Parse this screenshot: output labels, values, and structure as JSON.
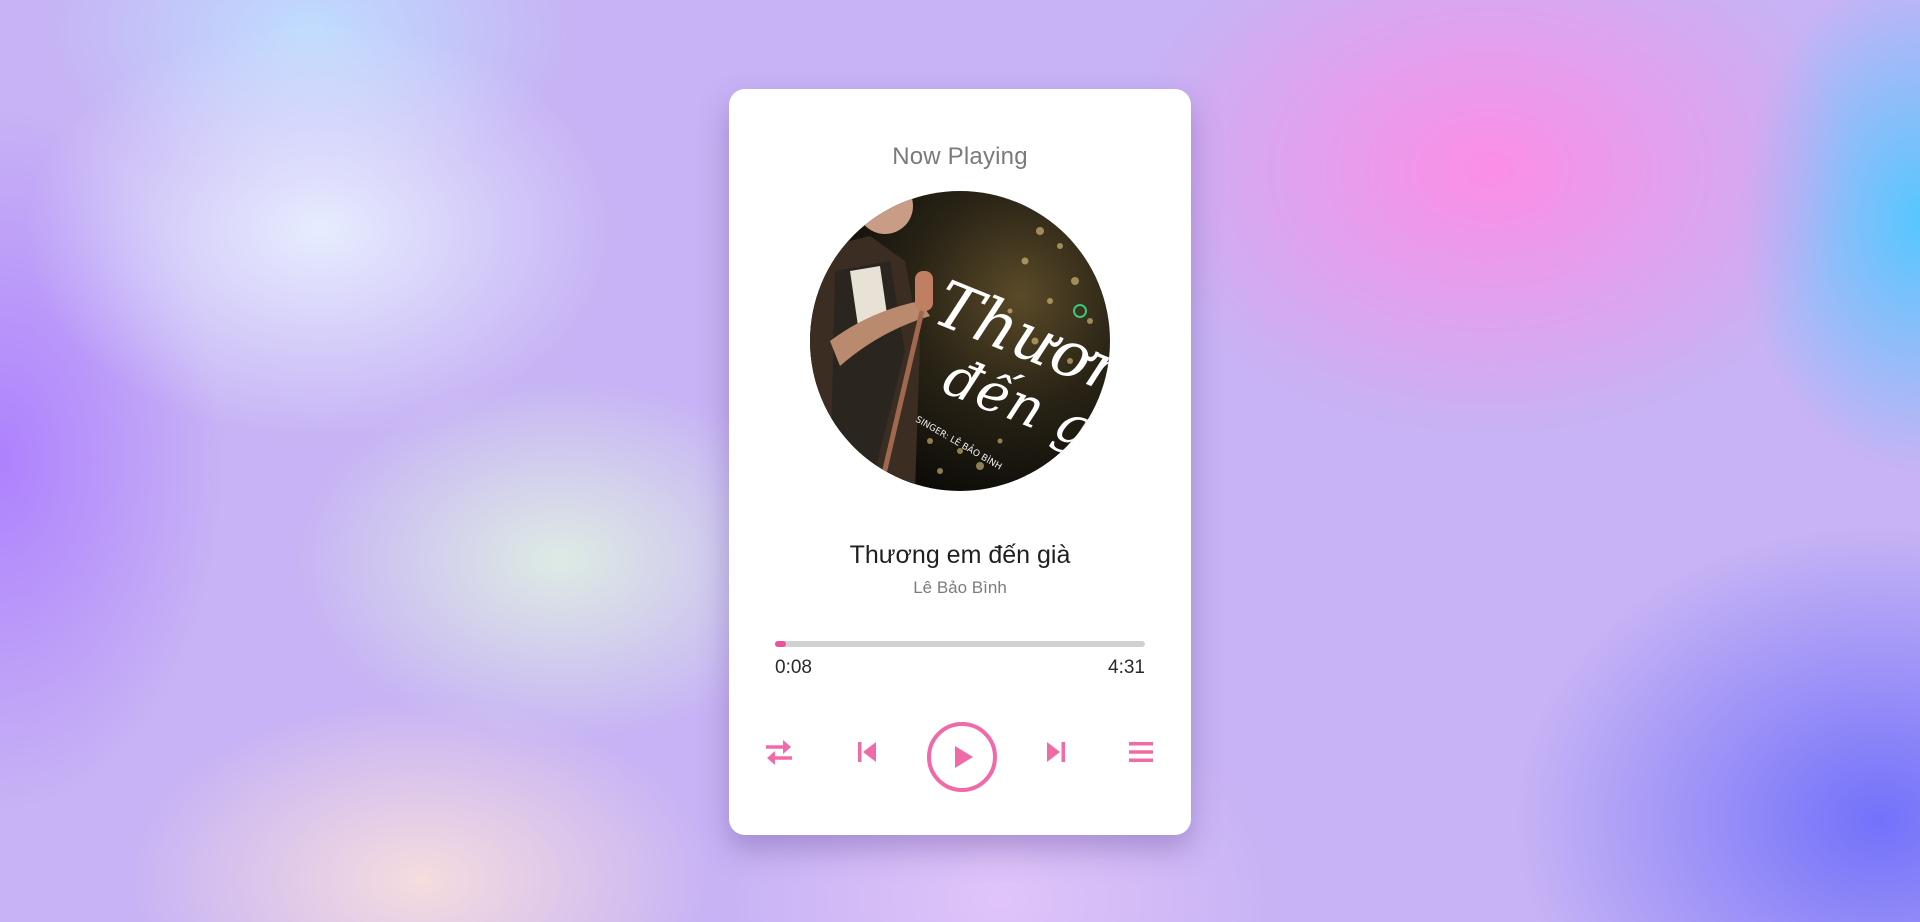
{
  "player": {
    "heading": "Now Playing",
    "song_title": "Thương em đến già",
    "song_artist": "Lê Bảo Bình",
    "current_time": "0:08",
    "total_time": "4:31",
    "progress_fraction": 0.031,
    "accent_color": "#f06aa8"
  },
  "cover_art": {
    "script_text_line1": "Thương",
    "script_text_line2": "đến già",
    "credit_text": "SINGER: LÊ BẢO BÌNH"
  },
  "controls": {
    "repeat_icon": "repeat-icon",
    "prev_icon": "skip-previous-icon",
    "play_icon": "play-icon",
    "next_icon": "skip-next-icon",
    "playlist_icon": "playlist-icon"
  }
}
